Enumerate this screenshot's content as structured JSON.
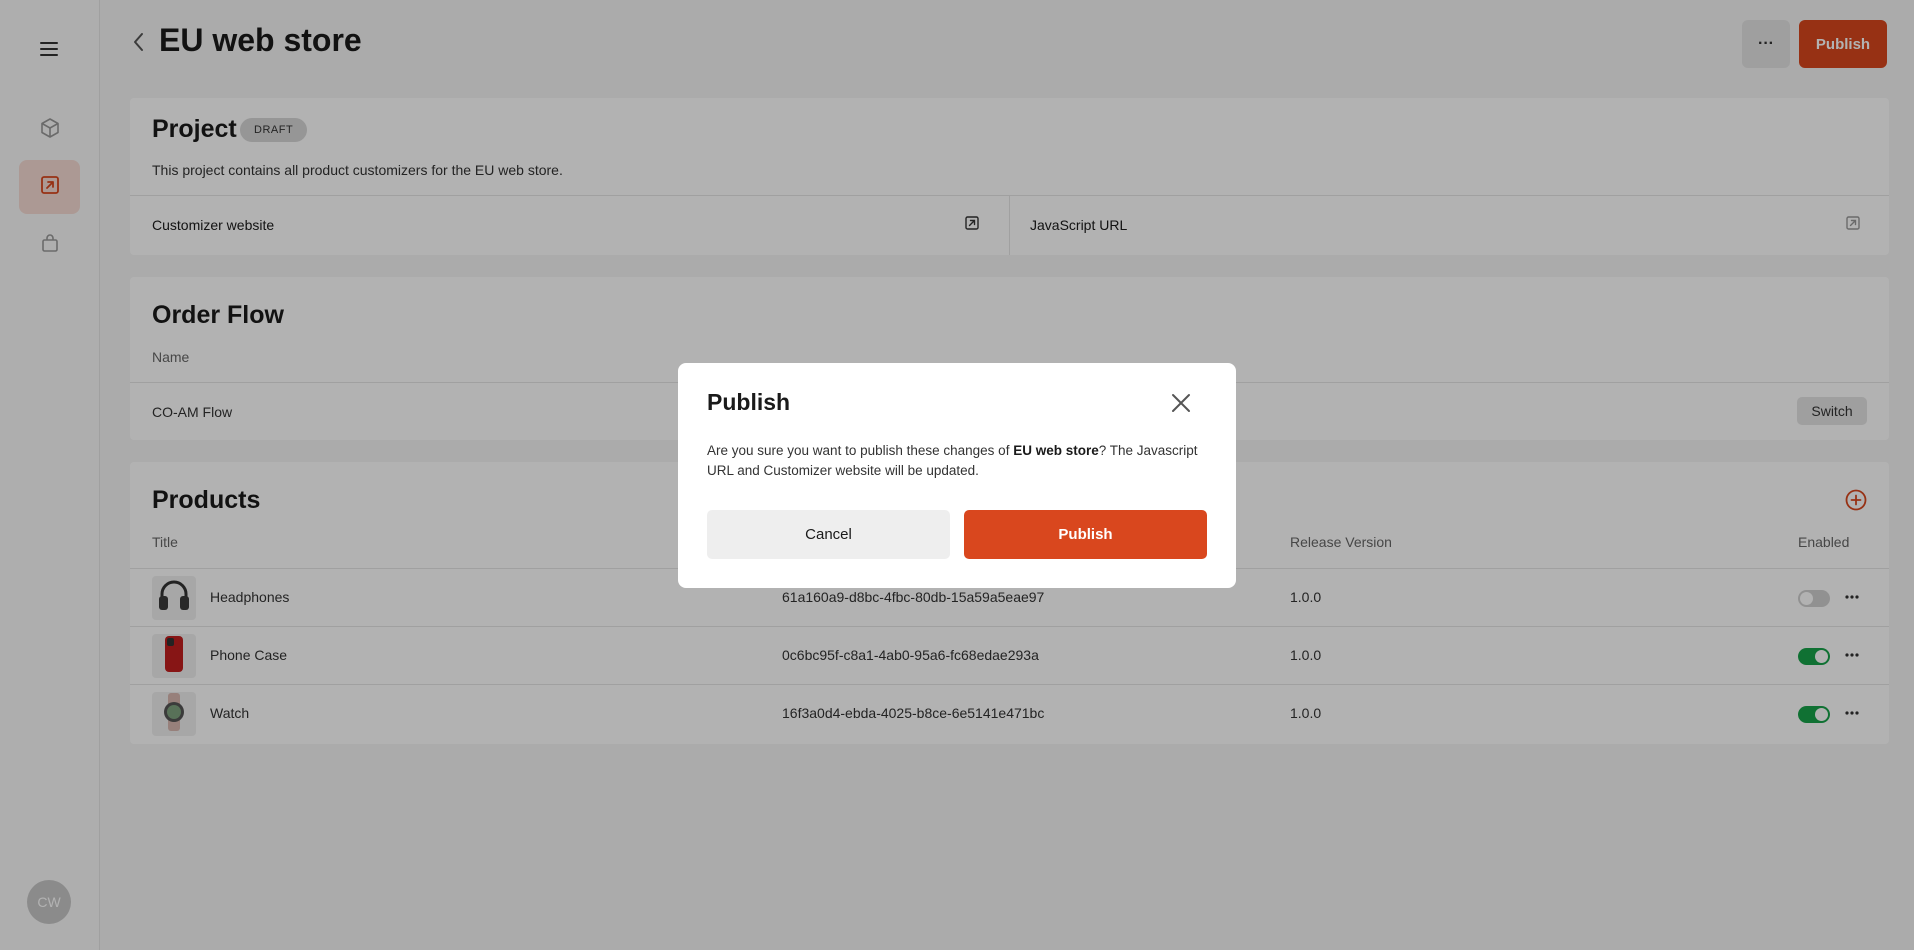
{
  "sidebar": {
    "menu_icon": "hamburger-icon",
    "items": [
      {
        "icon": "box-icon",
        "active": false
      },
      {
        "icon": "external-link-icon",
        "active": true
      },
      {
        "icon": "bag-icon",
        "active": false
      }
    ],
    "avatar_initials": "CW"
  },
  "header": {
    "title": "EU web store",
    "more_label": "···",
    "publish_label": "Publish"
  },
  "project": {
    "title": "Project",
    "status_badge": "DRAFT",
    "description": "This project contains all product customizers for the EU web store.",
    "customizer_website_label": "Customizer website",
    "javascript_url_label": "JavaScript URL"
  },
  "order_flow": {
    "title": "Order Flow",
    "column_name": "Name",
    "flow_name": "CO-AM Flow",
    "switch_label": "Switch"
  },
  "products": {
    "title": "Products",
    "columns": {
      "title": "Title",
      "release_version": "Release Version",
      "enabled": "Enabled"
    },
    "rows": [
      {
        "title": "Headphones",
        "id": "61a160a9-d8bc-4fbc-80db-15a59a5eae97",
        "version": "1.0.0",
        "enabled": false
      },
      {
        "title": "Phone Case",
        "id": "0c6bc95f-c8a1-4ab0-95a6-fc68edae293a",
        "version": "1.0.0",
        "enabled": true
      },
      {
        "title": "Watch",
        "id": "16f3a0d4-ebda-4025-b8ce-6e5141e471bc",
        "version": "1.0.0",
        "enabled": true
      }
    ]
  },
  "modal": {
    "title": "Publish",
    "text_before": "Are you sure you want to publish these changes of ",
    "text_bold": "EU web store",
    "text_after": "? The Javascript URL and Customizer website will be updated.",
    "cancel_label": "Cancel",
    "publish_label": "Publish"
  },
  "colors": {
    "accent": "#d9471e",
    "toggle_on": "#17a34a",
    "active_nav_bg": "#f6dcd4"
  }
}
